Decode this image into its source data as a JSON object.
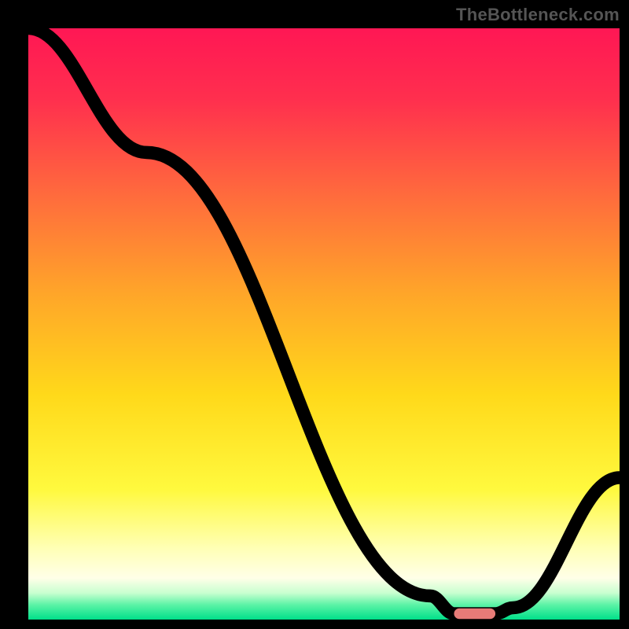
{
  "watermark": "TheBottleneck.com",
  "chart_data": {
    "type": "line",
    "title": "",
    "xlabel": "",
    "ylabel": "",
    "xlim": [
      0,
      100
    ],
    "ylim": [
      0,
      100
    ],
    "grid": false,
    "legend": false,
    "gradient_stops": [
      {
        "offset": 0.0,
        "color": "#ff1754"
      },
      {
        "offset": 0.12,
        "color": "#ff2f4e"
      },
      {
        "offset": 0.28,
        "color": "#ff6a3d"
      },
      {
        "offset": 0.45,
        "color": "#ffa629"
      },
      {
        "offset": 0.62,
        "color": "#ffd91a"
      },
      {
        "offset": 0.78,
        "color": "#fff93e"
      },
      {
        "offset": 0.88,
        "color": "#ffffb6"
      },
      {
        "offset": 0.93,
        "color": "#ffffe8"
      },
      {
        "offset": 0.955,
        "color": "#c8ffd0"
      },
      {
        "offset": 0.975,
        "color": "#5cf3a6"
      },
      {
        "offset": 1.0,
        "color": "#00e08a"
      }
    ],
    "series": [
      {
        "name": "bottleneck-curve",
        "x": [
          0,
          20,
          68,
          72,
          79,
          82,
          100
        ],
        "y": [
          100,
          79,
          4,
          1,
          1,
          2,
          24
        ]
      }
    ],
    "marker": {
      "x_start": 72,
      "x_end": 79,
      "y": 1,
      "color": "#e77b78"
    }
  }
}
